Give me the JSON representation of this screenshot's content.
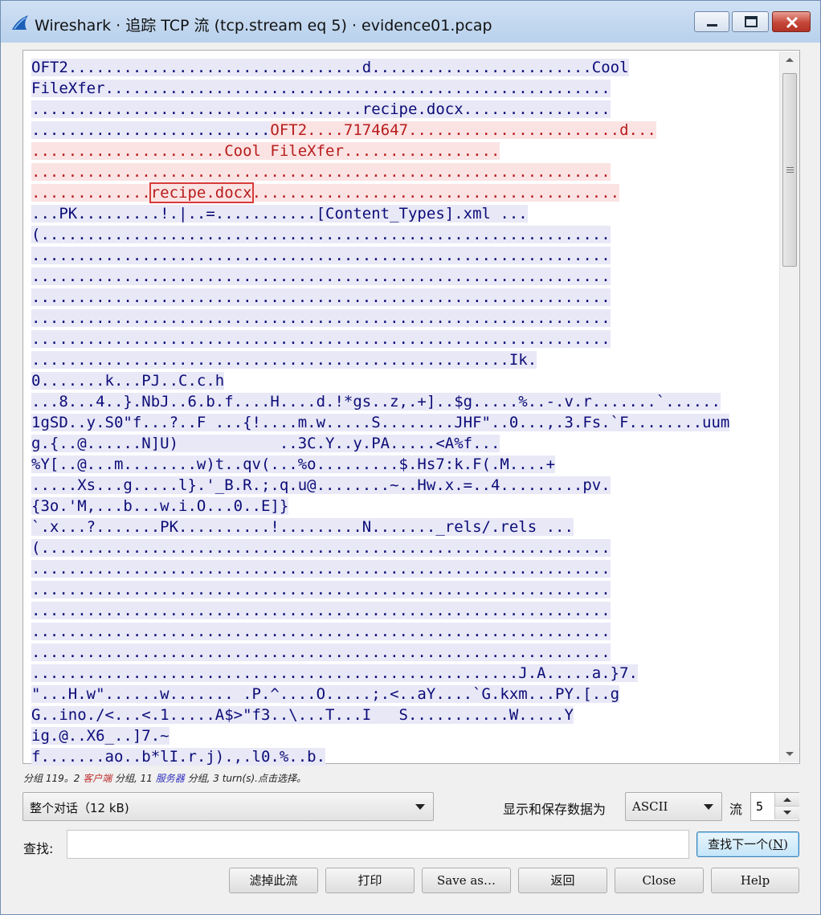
{
  "window": {
    "title": "Wireshark · 追踪 TCP 流 (tcp.stream eq 5) · evidence01.pcap"
  },
  "stream_lines": [
    {
      "dir": "client",
      "text": "OFT2................................d........................Cool"
    },
    {
      "dir": "client",
      "text": "FileXfer......................................................."
    },
    {
      "dir": "client",
      "text": "....................................recipe.docx................"
    },
    {
      "dir": "client",
      "text": "..........................",
      "rest_dir": "server",
      "rest": "OFT2....7174647.......................d..."
    },
    {
      "dir": "server",
      "text": ".....................Cool FileXfer................."
    },
    {
      "dir": "server",
      "text": "..............................................................."
    },
    {
      "dir": "server",
      "text": ".............",
      "highlight": "recipe.docx",
      "after": "........................................"
    },
    {
      "dir": "client",
      "text": "...PK.........!.|..=...........[Content_Types].xml ..."
    },
    {
      "dir": "client",
      "text": "(.............................................................."
    },
    {
      "dir": "client",
      "text": "..............................................................."
    },
    {
      "dir": "client",
      "text": "..............................................................."
    },
    {
      "dir": "client",
      "text": "..............................................................."
    },
    {
      "dir": "client",
      "text": "..............................................................."
    },
    {
      "dir": "client",
      "text": "..............................................................."
    },
    {
      "dir": "client",
      "text": "....................................................Ik."
    },
    {
      "dir": "client",
      "text": "0.......k...PJ..C.c.h"
    },
    {
      "dir": "client",
      "text": "...8...4..}.NbJ..6.b.f....H....d.!*gs..z,.+]..$g.....%..-.v.r.......`......"
    },
    {
      "dir": "client",
      "text": "1gSD..y.S0\"f...?..F ...{!....m.w.....S........JHF\"..0...,.3.Fs.`F........uum"
    },
    {
      "dir": "client",
      "text": "g.{..@......N]U)           ..3C.Y..y.PA.....<A%f..."
    },
    {
      "dir": "client",
      "text": "%Y[..@...m........w)t..qv(...%o.........$.Hs7:k.F(.M....+"
    },
    {
      "dir": "client",
      "text": ".....Xs...g.....l}.'_B.R.;.q.u@........~..Hw.x.=..4.........pv."
    },
    {
      "dir": "client",
      "text": "{3o.'M,...b...w.i.O...0..E]}"
    },
    {
      "dir": "client",
      "text": "`.x...?.......PK..........!.........N......._rels/.rels ..."
    },
    {
      "dir": "client",
      "text": "(.............................................................."
    },
    {
      "dir": "client",
      "text": "..............................................................."
    },
    {
      "dir": "client",
      "text": "..............................................................."
    },
    {
      "dir": "client",
      "text": "..............................................................."
    },
    {
      "dir": "client",
      "text": "..............................................................."
    },
    {
      "dir": "client",
      "text": "..............................................................."
    },
    {
      "dir": "client",
      "text": ".....................................................J.A.....a.}7."
    },
    {
      "dir": "client",
      "text": "\"...H.w\"......w....... .P.^....O.....;.<..aY....`G.kxm...PY.[..g"
    },
    {
      "dir": "client",
      "text": "G..ino./<...<.1.....A$>\"f3..\\...T...I   S...........W.....Y"
    },
    {
      "dir": "client",
      "text": "ig.@..X6_..]7.~"
    },
    {
      "dir": "client",
      "text": "f.......ao..b*lI.r.j).,.l0.%..b."
    }
  ],
  "status": {
    "prefix": "分组 119。2",
    "client_word": "客户端",
    "mid": "分组, 11",
    "server_word": "服务器",
    "suffix": "分组, 3 turn(s).点击选择。"
  },
  "conversation_select": {
    "value": "整个对话（12 kB)"
  },
  "format": {
    "label": "显示和保存数据为",
    "value": "ASCII"
  },
  "stream": {
    "label": "流",
    "value": "5"
  },
  "find": {
    "label": "查找:",
    "value": "",
    "button": "查找下一个",
    "mnemonic": "N"
  },
  "buttons": {
    "filter_out": "滤掉此流",
    "print": "打印",
    "save_as": "Save as…",
    "back": "返回",
    "close": "Close",
    "help": "Help"
  }
}
